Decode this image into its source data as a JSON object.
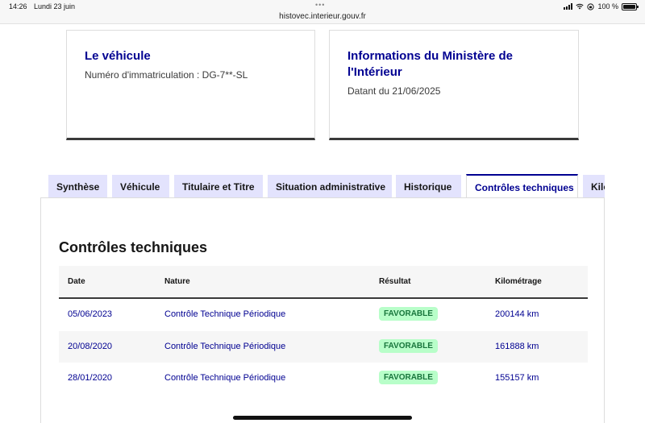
{
  "statusbar": {
    "time": "14:26",
    "date": "Lundi 23 juin",
    "dots": "•••",
    "url": "histovec.interieur.gouv.fr",
    "battery": "100 %",
    "battery_level": 1.0
  },
  "cards": {
    "vehicle": {
      "title": "Le véhicule",
      "text": "Numéro d'immatriculation : DG-7**-SL"
    },
    "ministry": {
      "title": "Informations du Ministère de l'Intérieur",
      "text": "Datant du 21/06/2025"
    }
  },
  "tabs": [
    {
      "label": "Synthèse"
    },
    {
      "label": "Véhicule"
    },
    {
      "label": "Titulaire et Titre"
    },
    {
      "label": "Situation administrative"
    },
    {
      "label": "Historique"
    },
    {
      "label": "Contrôles techniques",
      "active": true
    },
    {
      "label": "Kilo"
    }
  ],
  "section": {
    "title": "Contrôles techniques",
    "table": {
      "headers": [
        "Date",
        "Nature",
        "Résultat",
        "Kilométrage"
      ],
      "rows": [
        {
          "date": "05/06/2023",
          "nature": "Contrôle Technique Périodique",
          "result": "FAVORABLE",
          "km": "200144 km"
        },
        {
          "date": "20/08/2020",
          "nature": "Contrôle Technique Périodique",
          "result": "FAVORABLE",
          "km": "161888 km"
        },
        {
          "date": "28/01/2020",
          "nature": "Contrôle Technique Périodique",
          "result": "FAVORABLE",
          "km": "155157 km"
        }
      ]
    }
  },
  "colors": {
    "primary": "#000091",
    "tab_bg": "#e3e3fd",
    "success_bg": "#b8fec9",
    "success_text": "#18753c"
  }
}
